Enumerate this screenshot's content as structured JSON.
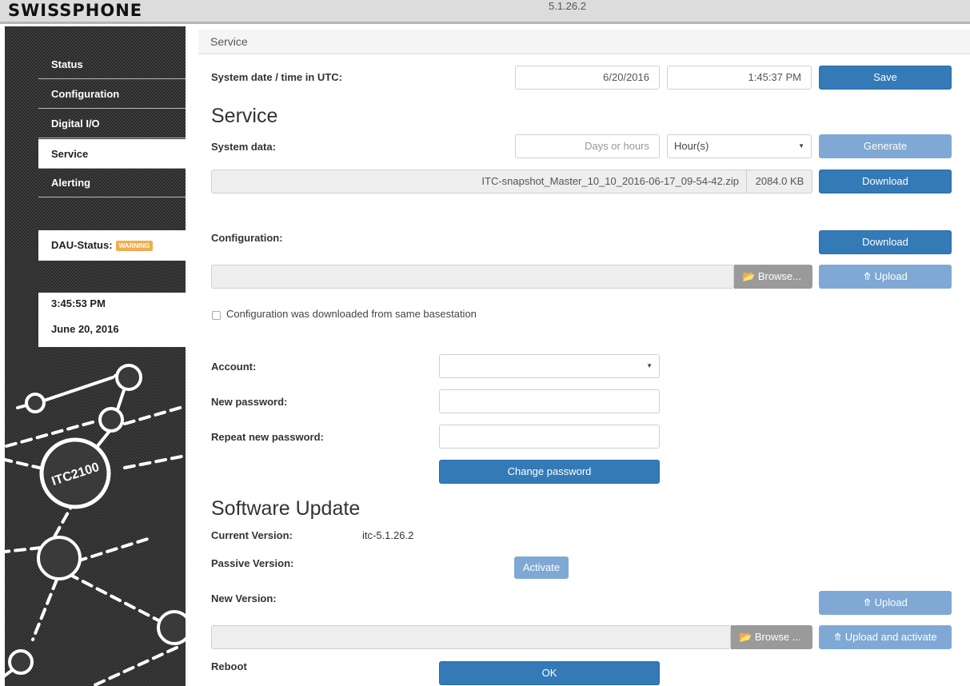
{
  "topbar": {
    "brand": "SWISSPHONE",
    "version": "5.1.26.2"
  },
  "sidebar": {
    "items": [
      {
        "label": "Status",
        "active": false
      },
      {
        "label": "Configuration",
        "active": false
      },
      {
        "label": "Digital I/O",
        "active": false
      },
      {
        "label": "Service",
        "active": true
      },
      {
        "label": "Alerting",
        "active": false
      }
    ],
    "dau_label": "DAU-Status:",
    "dau_badge": "WARNING",
    "time": "3:45:53 PM",
    "date": "June 20, 2016",
    "logo_text": "ITC2100"
  },
  "main": {
    "breadcrumb": "Service",
    "system_time": {
      "label": "System date / time in UTC:",
      "date_value": "6/20/2016",
      "time_value": "1:45:37 PM",
      "save_label": "Save"
    },
    "service_heading": "Service",
    "system_data": {
      "label": "System data:",
      "placeholder": "Days or hours",
      "unit_selected": "Hour(s)",
      "generate_label": "Generate"
    },
    "snapshot": {
      "filename": "ITC-snapshot_Master_10_10_2016-06-17_09-54-42.zip",
      "size": "2084.0 KB",
      "download_label": "Download"
    },
    "configuration": {
      "label": "Configuration:",
      "download_label": "Download",
      "browse_label": "Browse...",
      "upload_label": "Upload",
      "checkbox_label": "Configuration was downloaded from same basestation"
    },
    "account": {
      "account_label": "Account:",
      "account_value": "",
      "new_password_label": "New password:",
      "repeat_password_label": "Repeat new password:",
      "change_password_label": "Change password"
    },
    "software_update": {
      "heading": "Software Update",
      "current_label": "Current Version:",
      "current_value": "itc-5.1.26.2",
      "passive_label": "Passive Version:",
      "activate_label": "Activate",
      "new_label": "New Version:",
      "upload_label": "Upload",
      "browse_label": "Browse ...",
      "upload_activate_label": "Upload and activate"
    },
    "reboot": {
      "label": "Reboot",
      "ok_label": "OK"
    }
  },
  "colors": {
    "primary": "#337ab7",
    "primary_disabled": "#7fa9d4",
    "warning": "#f0ad4e",
    "sidebar_bg": "#2c2c2c"
  },
  "icons": {
    "folder": "folder-open-icon",
    "upload": "upload-circle-icon",
    "caret": "caret-down-icon"
  }
}
